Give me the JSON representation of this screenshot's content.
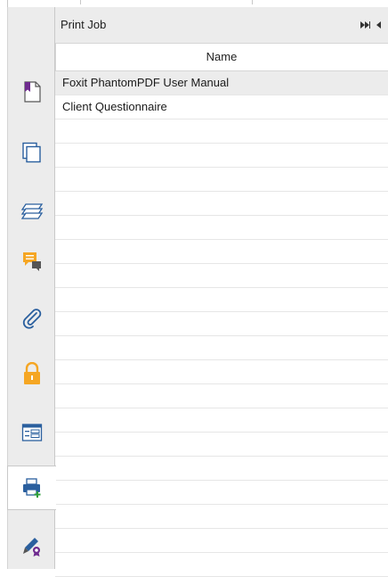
{
  "panel": {
    "title": "Print Job",
    "column_header": "Name",
    "rows": [
      {
        "name": "Foxit PhantomPDF User Manual",
        "selected": true
      },
      {
        "name": "Client Questionnaire",
        "selected": false
      }
    ],
    "empty_row_count": 19
  },
  "rail": {
    "items": [
      {
        "icon": "bookmark-icon"
      },
      {
        "icon": "pages-icon"
      },
      {
        "icon": "layers-icon"
      },
      {
        "icon": "comments-icon"
      },
      {
        "icon": "attachments-icon"
      },
      {
        "icon": "security-icon"
      },
      {
        "icon": "form-fields-icon"
      },
      {
        "icon": "print-job-icon",
        "active": true
      },
      {
        "icon": "digital-signature-icon"
      }
    ]
  },
  "colors": {
    "accent_orange": "#f5a623",
    "accent_blue": "#2a5f9e",
    "accent_purple": "#6f2b8f",
    "accent_green": "#2e9e3a",
    "panel_bg": "#ececec"
  }
}
